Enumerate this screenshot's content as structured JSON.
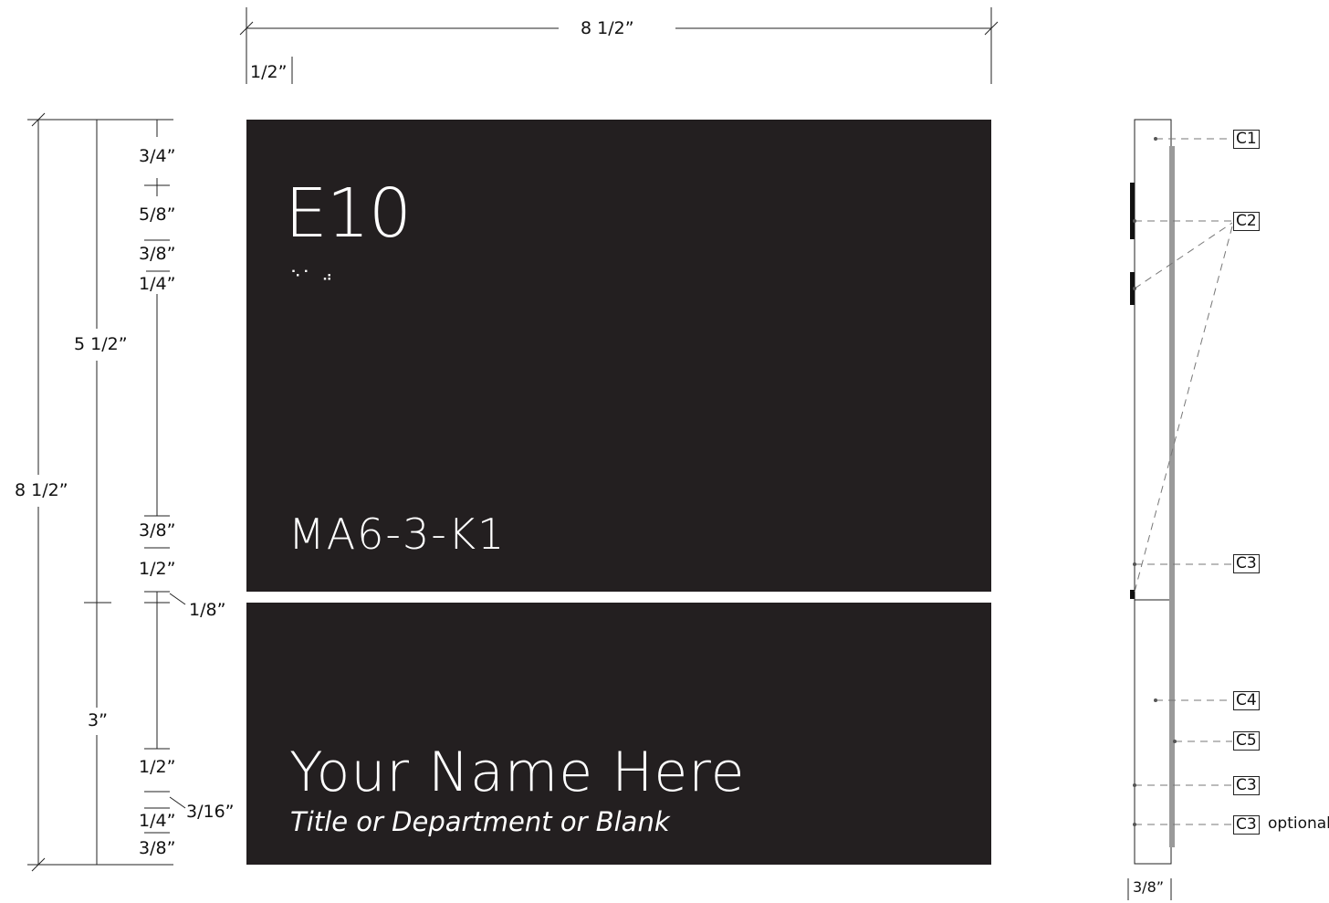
{
  "top_dims": {
    "overall_width": "8 1/2”",
    "margin": "1/2”"
  },
  "left_dims": {
    "overall_height": "8 1/2”",
    "upper_panel": "5 1/2”",
    "lower_panel": "3”",
    "stack": [
      "3/4”",
      "5/8”",
      "3/8”",
      "1/4”",
      "3/8”",
      "1/2”",
      "1/8”",
      "1/2”",
      "3/16”",
      "1/4”",
      "3/8”"
    ]
  },
  "sign": {
    "room_number": "E10",
    "braille": "⠑⠁ ⠴",
    "room_code": "MA6-3-K1",
    "name": "Your Name Here",
    "title": "Title or Department or Blank"
  },
  "side_view": {
    "callouts": [
      "C1",
      "C2",
      "C3",
      "C4",
      "C5",
      "C3",
      "C3"
    ],
    "optional_note": "optional",
    "depth": "3/8”"
  },
  "colors": {
    "panel": "#231f20",
    "line": "#222222",
    "dashed": "#777777"
  }
}
